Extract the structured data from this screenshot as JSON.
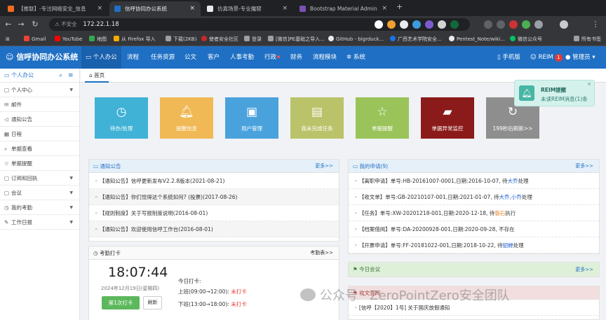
{
  "browser": {
    "tabs": [
      {
        "label": "【推联】-专注网络安全_信息"
      },
      {
        "label": "信呼协同办公系统"
      },
      {
        "label": "仿真场景-专业魔窟"
      },
      {
        "label": "Bootstrap Material Admin"
      }
    ],
    "new_tab": "+",
    "url_security": "不安全",
    "url": "172.22.1.18",
    "bookmarks": [
      "Gmail",
      "YouTube",
      "地图",
      "从 Firefox 导入",
      "下载(2KB)",
      "使者安全社区",
      "登录",
      "[微信]PE基础之导入...",
      "GitHub - bigrduck...",
      "广西艺术学院安全...",
      "Pentest_Note/wiki...",
      "微信公众号"
    ],
    "all_bookmarks": "所有书签"
  },
  "app": {
    "title": "信呼协同办公系统",
    "nav": [
      "个人办公",
      "流程",
      "任务资源",
      "公文",
      "客户",
      "人事考勤",
      "行政",
      "财务",
      "流程模块",
      "系统"
    ],
    "mobile": "手机版",
    "reim": "REIM",
    "reim_count": "1",
    "user": "管理员"
  },
  "sidebar": {
    "header": "个人办公",
    "items": [
      {
        "label": "个人中心",
        "caret": true
      },
      {
        "label": "邮件"
      },
      {
        "label": "通知公告"
      },
      {
        "label": "日程"
      },
      {
        "label": "单据查看"
      },
      {
        "label": "单据提醒"
      },
      {
        "label": "订阅和回执",
        "caret": true
      },
      {
        "label": "会议",
        "caret": true
      },
      {
        "label": "我的考勤",
        "caret": true
      },
      {
        "label": "工作日报",
        "caret": true
      }
    ]
  },
  "content": {
    "home_tab": "首页",
    "tiles": [
      {
        "label": "待办/处理",
        "color": "#3fb2d6"
      },
      {
        "label": "提醒信息",
        "color": "#f0b955"
      },
      {
        "label": "用户管理",
        "color": "#4aa2dd"
      },
      {
        "label": "我未完成任务",
        "color": "#bac369"
      },
      {
        "label": "单据提醒",
        "color": "#9ac45a"
      },
      {
        "label": "单据异常监控",
        "color": "#8b1a1a"
      },
      {
        "label": "199秒后刷新>>",
        "color": "#8e8e8e"
      }
    ],
    "notice": {
      "title": "通知公告",
      "more": "更多>>",
      "rows": [
        "【通知公告】信呼更新发布V2.2.8版本(2021-08-21)",
        "【通知公告】你们觉得这个系统如何? (投票)(2017-08-26)",
        "【规则制度】关于写报制度说明(2016-08-01)",
        "【通知公告】欢迎使用信呼工作台(2016-08-01)"
      ]
    },
    "apply": {
      "title": "我的申请(9)",
      "more": "更多>>",
      "rows": [
        {
          "text": "【离职申请】单号:HB-20161007-0001,日期:2016-10-07, 待",
          "who": "大乔",
          "tail": "处理",
          "cls": "blue"
        },
        {
          "text": "【收文单】单号:GB-20210107-001,日期:2021-01-07, 待",
          "who": "大乔,小乔",
          "tail": "处理",
          "cls": "blue"
        },
        {
          "text": "【任务】单号:XW-20201218-001,日期:2020-12-18, 待",
          "who": "磐石",
          "tail": "执行",
          "cls": "orange"
        },
        {
          "text": "【档案借阅】单号:DA-20200928-001,日期:2020-09-28, 不存在",
          "who": "",
          "tail": "",
          "cls": ""
        },
        {
          "text": "【开票申请】单号:FF-20181022-001,日期:2018-10-22, 待",
          "who": "貂蝉",
          "tail": "处理",
          "cls": "blue"
        }
      ]
    },
    "punch": {
      "title": "考勤打卡",
      "link": "考勤表>>",
      "time": "18:07:44",
      "date": "2024年12月19日(星期四)",
      "btn": "第1次打卡",
      "refresh": "刷新",
      "today_label": "今日打卡:",
      "morning": "上班(09:00→12:00):",
      "afternoon": "下班(13:00→18:00):",
      "status": "未打卡"
    },
    "meeting": {
      "title": "今日会议",
      "more": "更多>>"
    },
    "doc": {
      "title": "收文查阅",
      "row": "[信呼【2020】1号] 关于国庆放假通知"
    }
  },
  "notification": {
    "title": "REIM提醒",
    "body": "未读REIM消息(1)条",
    "close": "×"
  },
  "watermark": "公众号 · ZeroPointZero安全团队",
  "colors": {
    "header": "#1f70c4",
    "accent": "#1f70c4",
    "meeting_head": "#dff0d8"
  }
}
